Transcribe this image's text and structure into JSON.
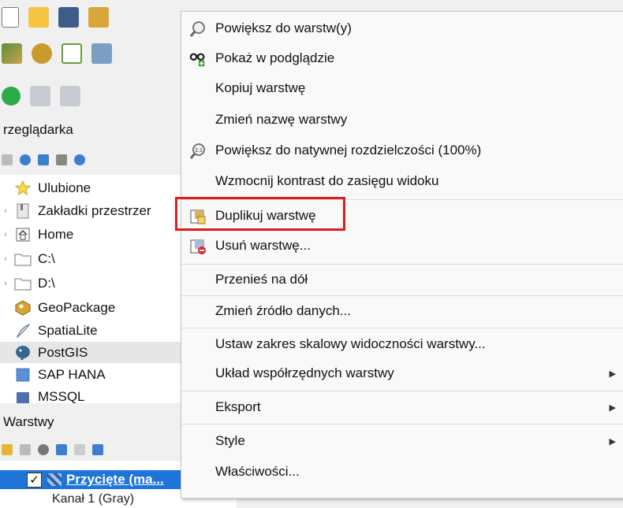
{
  "browser": {
    "title": "rzeglądarka",
    "items": [
      {
        "label": "Ulubione",
        "icon": "star-icon"
      },
      {
        "label": "Zakładki przestrzer",
        "icon": "bookmark-icon"
      },
      {
        "label": "Home",
        "icon": "home-icon"
      },
      {
        "label": "C:\\",
        "icon": "folder-icon"
      },
      {
        "label": "D:\\",
        "icon": "folder-icon"
      },
      {
        "label": "GeoPackage",
        "icon": "geopackage-icon"
      },
      {
        "label": "SpatiaLite",
        "icon": "spatialite-icon"
      },
      {
        "label": "PostGIS",
        "icon": "postgis-icon"
      },
      {
        "label": "SAP HANA",
        "icon": "sap-hana-icon"
      },
      {
        "label": "MSSQL",
        "icon": "mssql-icon"
      }
    ]
  },
  "layers": {
    "title": "Warstwy",
    "selected_layer": "Przycięte (ma...",
    "sub_item": "Kanał 1 (Gray)"
  },
  "menu": {
    "items": [
      {
        "label": "Powiększ do warstw(y)",
        "icon": "zoom-layer-icon"
      },
      {
        "label": "Pokaż w podglądzie",
        "icon": "overview-icon"
      },
      {
        "label": "Kopiuj warstwę"
      },
      {
        "label": "Zmień nazwę warstwy"
      },
      {
        "label": "Powiększ do natywnej rozdzielczości (100%)",
        "icon": "zoom-native-icon"
      },
      {
        "label": "Wzmocnij kontrast do zasięgu widoku"
      },
      {
        "label": "Duplikuj warstwę",
        "icon": "duplicate-layer-icon",
        "highlighted": true
      },
      {
        "label": "Usuń warstwę...",
        "icon": "remove-layer-icon"
      },
      {
        "label": "Przenieś na dół"
      },
      {
        "label": "Zmień źródło danych..."
      },
      {
        "label": "Ustaw zakres skalowy widoczności warstwy..."
      },
      {
        "label": "Układ współrzędnych warstwy",
        "submenu": true
      },
      {
        "label": "Eksport",
        "submenu": true
      },
      {
        "label": "Style",
        "submenu": true
      },
      {
        "label": "Właściwości..."
      }
    ],
    "highlight_color": "#e01b1b"
  }
}
